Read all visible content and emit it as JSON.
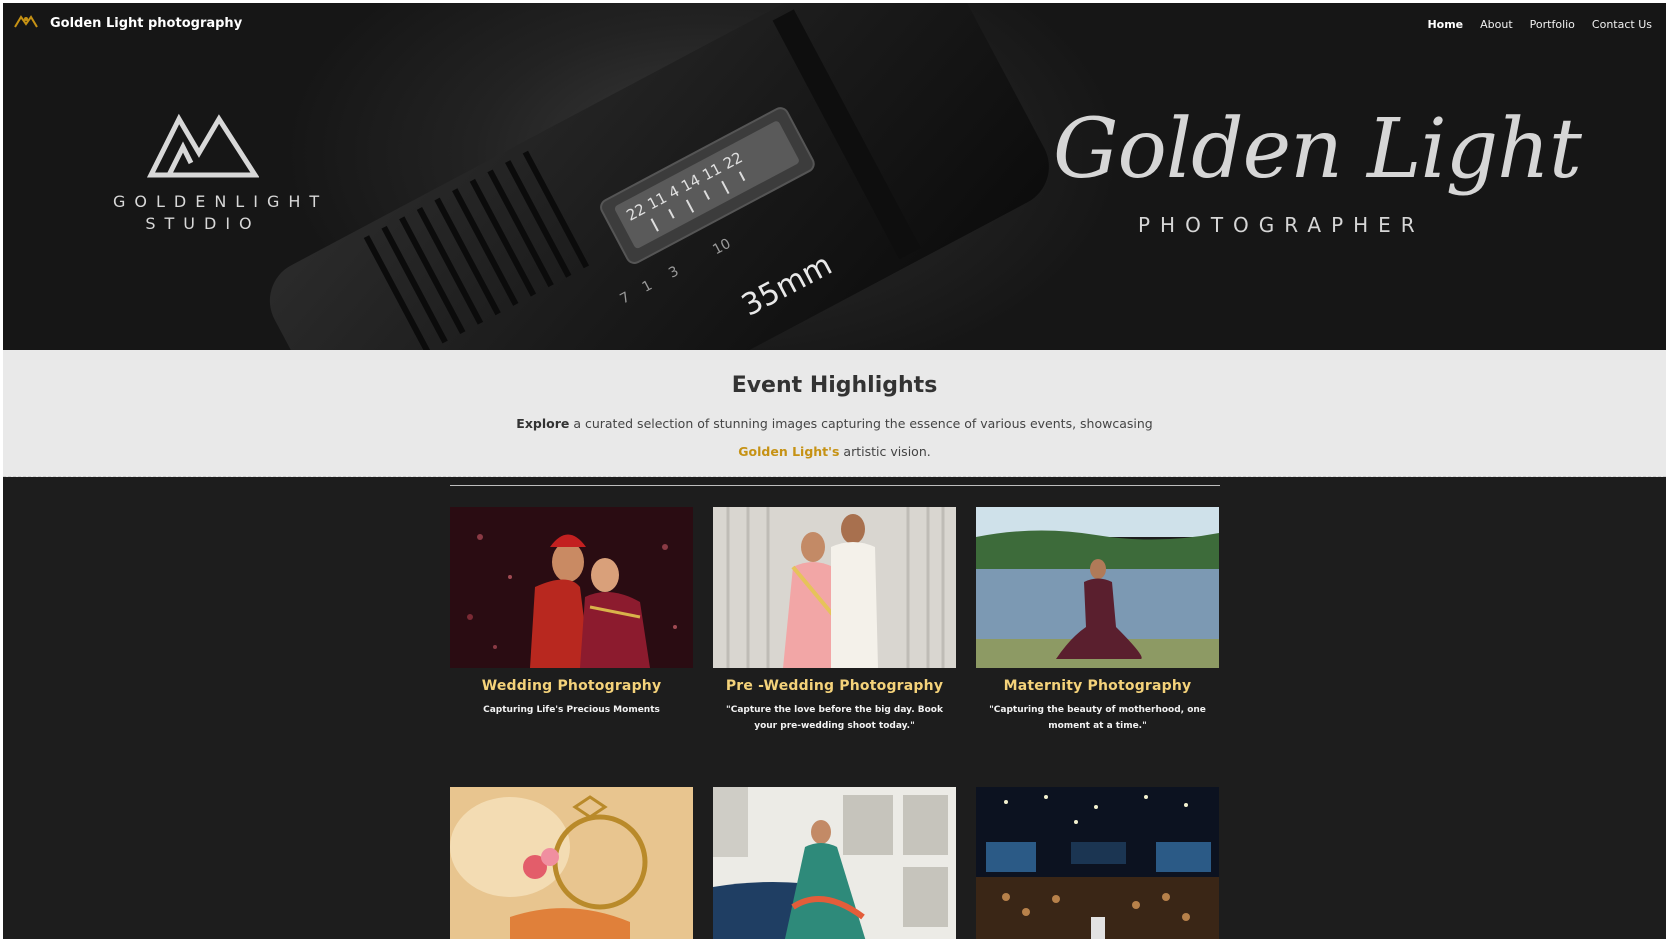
{
  "nav": {
    "brand": "Golden Light photography",
    "links": [
      {
        "label": "Home",
        "active": true
      },
      {
        "label": "About",
        "active": false
      },
      {
        "label": "Portfolio",
        "active": false
      },
      {
        "label": "Contact Us",
        "active": false
      }
    ]
  },
  "hero": {
    "studio_line1": "GOLDENLIGHT",
    "studio_line2": "STUDIO",
    "script_title": "Golden Light",
    "script_subtitle": "PHOTOGRAPHER",
    "lens_markings": [
      "22 11 4 14 11 22",
      "10",
      "3",
      "1",
      "7",
      "35mm"
    ]
  },
  "highlights": {
    "title": "Event Highlights",
    "intro_bold": "Explore",
    "intro_rest": " a curated selection of stunning images capturing the essence of various events, showcasing",
    "brand_highlight": "Golden Light's",
    "intro_end": " artistic vision.",
    "accent_color": "#c69214"
  },
  "cards": [
    {
      "title": "Wedding Photography",
      "caption": "Capturing Life's Precious Moments",
      "image": "wedding-couple-photo"
    },
    {
      "title": "Pre -Wedding Photography",
      "caption": "\"Capture the love before the big day.  Book your pre-wedding shoot today.\"",
      "image": "pre-wedding-couple-photo"
    },
    {
      "title": "Maternity Photography",
      "caption": "\"Capturing the beauty of motherhood, one moment at a time.\"",
      "image": "maternity-lake-photo"
    },
    {
      "title": "",
      "caption": "",
      "image": "ring-ceremony-photo"
    },
    {
      "title": "",
      "caption": "",
      "image": "bride-portrait-photo"
    },
    {
      "title": "",
      "caption": "",
      "image": "corporate-event-photo"
    }
  ]
}
